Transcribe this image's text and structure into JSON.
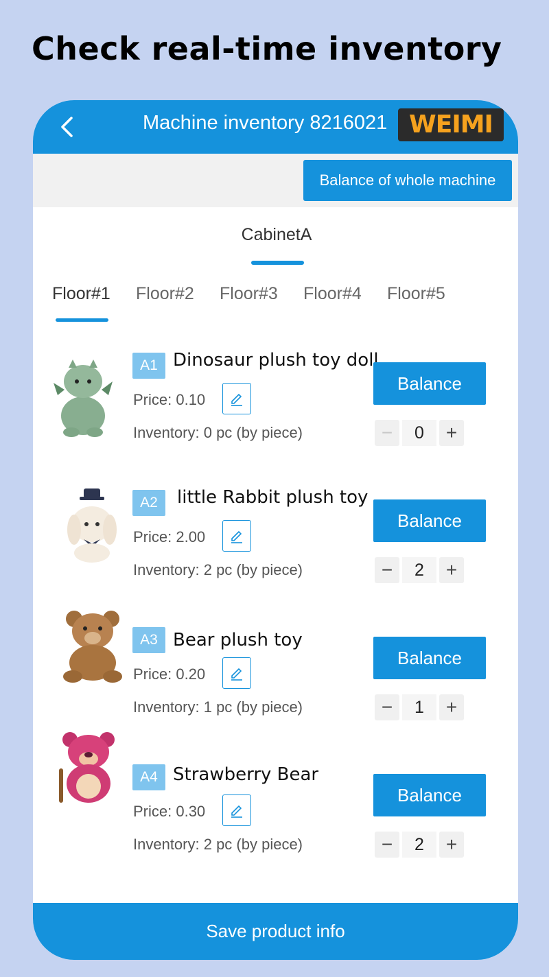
{
  "promo": {
    "heading": "Check real-time inventory"
  },
  "header": {
    "title": "Machine inventory 8216021",
    "brand": "WEIMI",
    "back_icon": "chevron-left-icon"
  },
  "toolbar": {
    "whole_balance_label": "Balance of whole machine"
  },
  "cabinet_tab": "CabinetA",
  "floor_tabs": [
    "Floor#1",
    "Floor#2",
    "Floor#3",
    "Floor#4",
    "Floor#5"
  ],
  "active_floor": "Floor#1",
  "products": [
    {
      "slot": "A1",
      "name": "Dinosaur plush toy doll",
      "price": "Price: 0.10",
      "inventory": "Inventory: 0 pc (by piece)",
      "balance_label": "Balance",
      "quantity": "0",
      "image": "dinosaur-plush-image"
    },
    {
      "slot": "A2",
      "name": "little Rabbit plush toy",
      "price": "Price: 2.00",
      "inventory": "Inventory: 2 pc (by piece)",
      "balance_label": "Balance",
      "quantity": "2",
      "image": "rabbit-plush-image"
    },
    {
      "slot": "A3",
      "name": "Bear plush toy",
      "price": "Price: 0.20",
      "inventory": "Inventory: 1 pc (by piece)",
      "balance_label": "Balance",
      "quantity": "1",
      "image": "bear-plush-image"
    },
    {
      "slot": "A4",
      "name": "Strawberry Bear",
      "price": "Price: 0.30",
      "inventory": "Inventory: 2 pc (by piece)",
      "balance_label": "Balance",
      "quantity": "2",
      "image": "strawberry-bear-image"
    }
  ],
  "stepper": {
    "minus": "−",
    "plus": "+"
  },
  "footer": {
    "save_label": "Save product info"
  },
  "colors": {
    "background": "#c5d3f1",
    "primary": "#1592dc",
    "badge": "#7fc4ee",
    "brand_text": "#f6a21e"
  }
}
